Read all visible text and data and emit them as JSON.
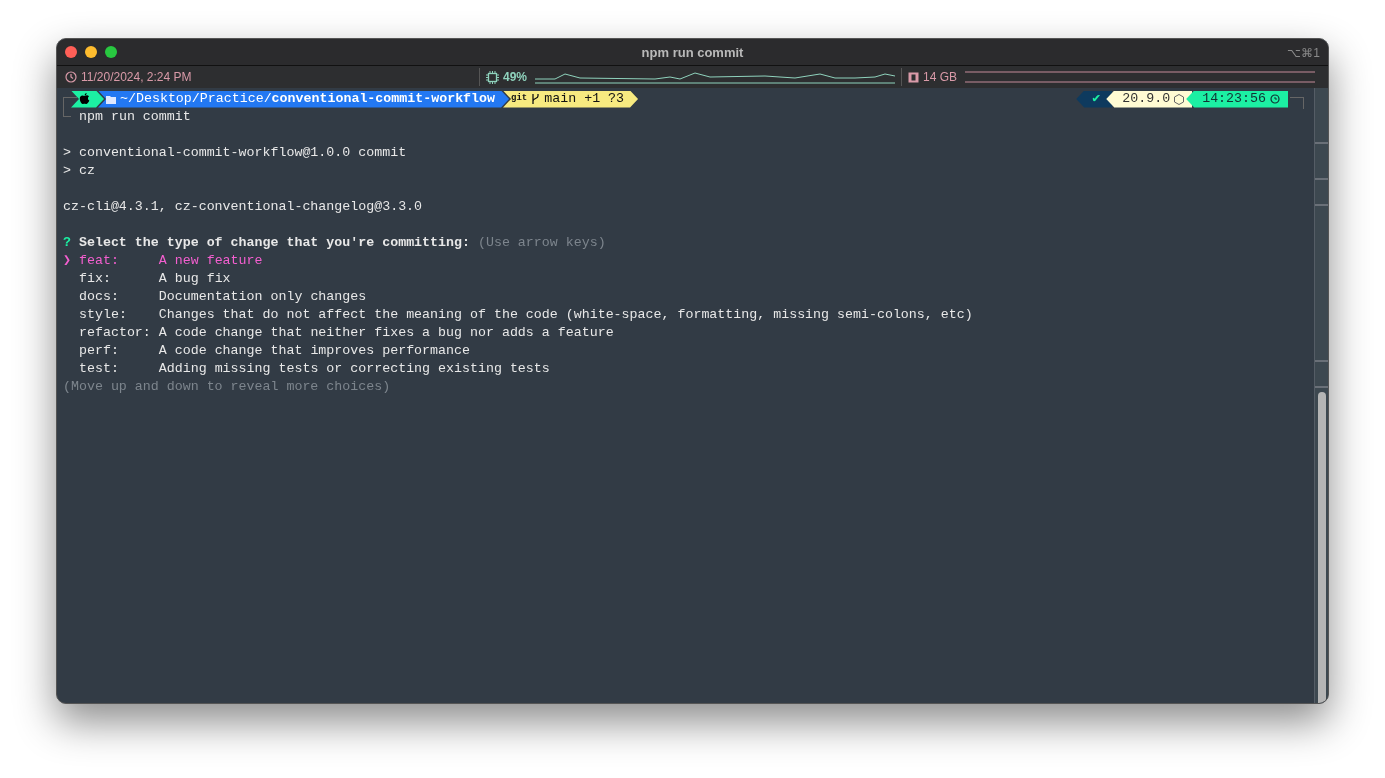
{
  "window": {
    "title": "npm run commit",
    "shortcut": "⌥⌘1"
  },
  "status_bar": {
    "datetime": "11/20/2024, 2:24 PM",
    "cpu": "49%",
    "memory": "14 GB"
  },
  "prompt": {
    "path": "~/Desktop/Practice/**conventional-commit-workflow**",
    "git_label": "git",
    "git_status": "main +1 ?3",
    "status_mark": "✔",
    "node_version": "20.9.0",
    "time": "14:23:56"
  },
  "command": "npm run commit",
  "output": [
    [
      "> conventional-commit-workflow@1.0.0 commit",
      "> cz"
    ],
    [
      "cz-cli@4.3.1, cz-conventional-changelog@3.3.0"
    ]
  ],
  "question": {
    "mark": "?",
    "text": "Select the type of change that you're committing:",
    "hint": "(Use arrow keys)"
  },
  "pointer": "❯",
  "choices": [
    {
      "key": "feat:",
      "description": "A new feature",
      "selected": true
    },
    {
      "key": "fix:",
      "description": "A bug fix",
      "selected": false
    },
    {
      "key": "docs:",
      "description": "Documentation only changes",
      "selected": false
    },
    {
      "key": "style:",
      "description": "Changes that do not affect the meaning of the code (white-space, formatting, missing semi-colons, etc)",
      "selected": false
    },
    {
      "key": "refactor:",
      "description": "A code change that neither fixes a bug nor adds a feature",
      "selected": false
    },
    {
      "key": "perf:",
      "description": "A code change that improves performance",
      "selected": false
    },
    {
      "key": "test:",
      "description": "Adding missing tests or correcting existing tests",
      "selected": false
    }
  ],
  "footer_hint": "(Move up and down to reveal more choices)"
}
